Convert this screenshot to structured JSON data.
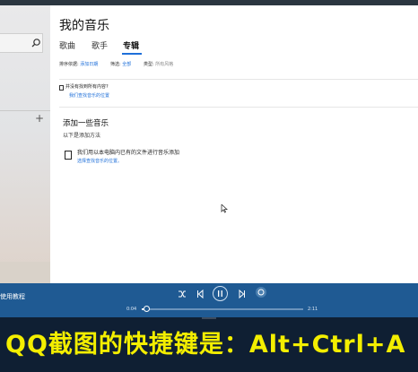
{
  "main": {
    "title": "我的音乐",
    "tabs": [
      {
        "label": "歌曲"
      },
      {
        "label": "歌手"
      },
      {
        "label": "专辑"
      }
    ],
    "filters": {
      "sort_label": "排序依据:",
      "sort_value": "添加日期",
      "filter_label": "筛选:",
      "filter_value": "全部",
      "type_label": "类型:",
      "type_value": "所有风格"
    },
    "not_found": {
      "question": "并没有找到所有内容?",
      "link": "我们查找音乐的位置"
    },
    "add_music": {
      "heading": "添加一些音乐",
      "subheading": "以下是添加方法",
      "file_desc": "我们用以本电脑内已有的文件进行音乐添加",
      "file_link": "选择查找音乐的位置。"
    }
  },
  "player": {
    "now_playing": "使用教程",
    "time_elapsed": "0:04",
    "time_total": "2:11",
    "progress": 0.03
  },
  "caption": {
    "text": "QQ截图的快捷键是：Alt+Ctrl+A"
  },
  "colors": {
    "accent": "#1e6fd9",
    "player_bg": "#1f5a93",
    "caption": "#f3ee00"
  }
}
